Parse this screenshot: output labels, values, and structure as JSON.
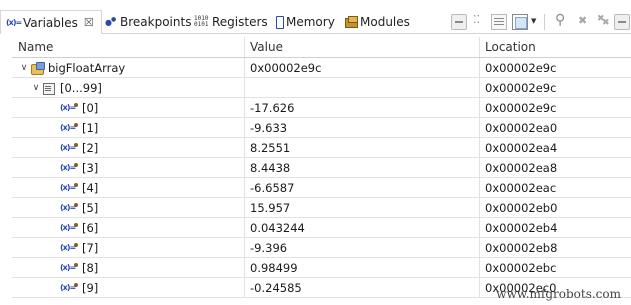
{
  "tabs": [
    {
      "label": "Variables",
      "icon": "variables-icon",
      "active": true
    },
    {
      "label": "Breakpoints",
      "icon": "breakpoints-icon",
      "active": false
    },
    {
      "label": "Registers",
      "icon": "registers-icon",
      "active": false
    },
    {
      "label": "Memory",
      "icon": "memory-icon",
      "active": false
    },
    {
      "label": "Modules",
      "icon": "modules-icon",
      "active": false
    }
  ],
  "tab_close_glyph": "☒",
  "register_icon_text": "1010\n0101",
  "toolbar": [
    "collapse-all-icon",
    "select-columns-icon",
    "layout-icon",
    "view-menu-icon",
    "view-menu-dropdown-icon",
    "pin-icon",
    "remove-icon",
    "remove-all-icon"
  ],
  "columns": {
    "name": "Name",
    "value": "Value",
    "location": "Location"
  },
  "rows": [
    {
      "name": "bigFloatArray",
      "value": "0x00002e9c",
      "location": "0x00002e9c",
      "twisty": "∨",
      "icon": "struct-icon"
    },
    {
      "name": "[0...99]",
      "value": "",
      "location": "0x00002e9c",
      "twisty": "∨",
      "icon": "array-icon"
    },
    {
      "name": "[0]",
      "value": "-17.626",
      "location": "0x00002e9c",
      "icon": "variable-icon"
    },
    {
      "name": "[1]",
      "value": "-9.633",
      "location": "0x00002ea0",
      "icon": "variable-icon"
    },
    {
      "name": "[2]",
      "value": "8.2551",
      "location": "0x00002ea4",
      "icon": "variable-icon"
    },
    {
      "name": "[3]",
      "value": "8.4438",
      "location": "0x00002ea8",
      "icon": "variable-icon"
    },
    {
      "name": "[4]",
      "value": "-6.6587",
      "location": "0x00002eac",
      "icon": "variable-icon"
    },
    {
      "name": "[5]",
      "value": "15.957",
      "location": "0x00002eb0",
      "icon": "variable-icon"
    },
    {
      "name": "[6]",
      "value": "0.043244",
      "location": "0x00002eb4",
      "icon": "variable-icon"
    },
    {
      "name": "[7]",
      "value": "-9.396",
      "location": "0x00002eb8",
      "icon": "variable-icon"
    },
    {
      "name": "[8]",
      "value": "0.98499",
      "location": "0x00002ebc",
      "icon": "variable-icon"
    },
    {
      "name": "[9]",
      "value": "-0.24585",
      "location": "0x00002ec0",
      "icon": "variable-icon"
    }
  ],
  "watermark": "www.mfgrobots.com",
  "colors": {
    "icon_blue": "#2b4aa8",
    "struct_gold": "#e9c15c",
    "grid_line": "#e2e2e2"
  }
}
